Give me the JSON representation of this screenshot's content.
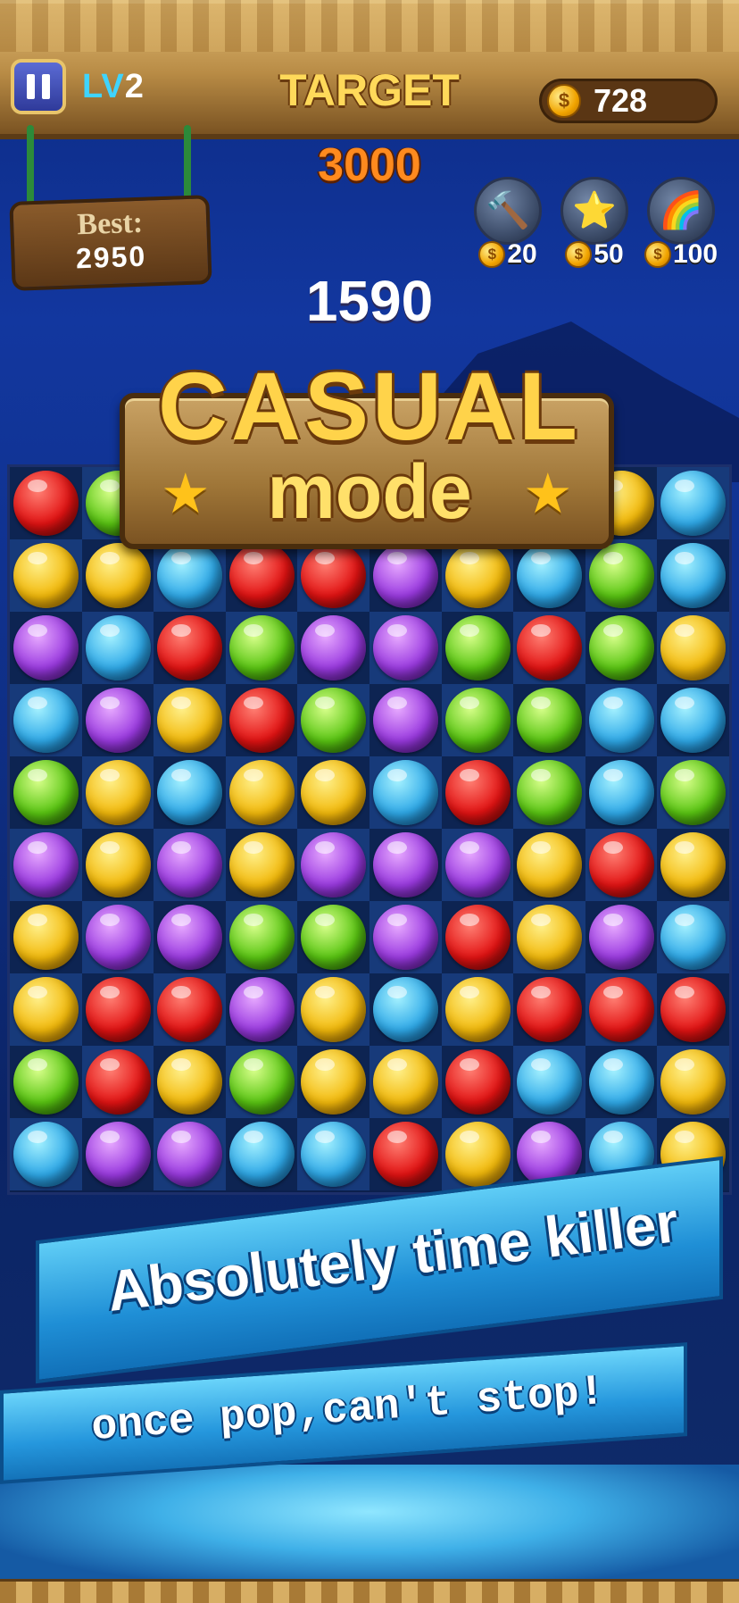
{
  "hud": {
    "level_prefix": "LV",
    "level": "2",
    "target_label": "TARGET",
    "target_value": "3000",
    "coins": "728",
    "coin_symbol": "$"
  },
  "best": {
    "label": "Best:",
    "value": "2950"
  },
  "boosters": [
    {
      "name": "hammer",
      "icon": "hammer-icon",
      "glyph": "🔨",
      "cost": "20"
    },
    {
      "name": "magic-wand",
      "icon": "star-wand-icon",
      "glyph": "⭐",
      "cost": "50"
    },
    {
      "name": "rainbow-ball",
      "icon": "rainbow-ball-icon",
      "glyph": "🌈",
      "cost": "100"
    }
  ],
  "score": "1590",
  "mode": {
    "title": "CASUAL",
    "subtitle": "mode"
  },
  "promo": {
    "slogan": "Absolutely time killer",
    "tagline": "once pop,can't stop!"
  },
  "board": {
    "rows": [
      [
        "red",
        "green",
        "",
        "",
        "",
        "",
        "",
        "",
        "yellow",
        "blue"
      ],
      [
        "yellow",
        "yellow",
        "blue",
        "red",
        "red",
        "purple",
        "yellow",
        "blue",
        "green",
        "blue"
      ],
      [
        "purple",
        "blue",
        "red",
        "green",
        "purple",
        "purple",
        "green",
        "red",
        "green",
        "yellow"
      ],
      [
        "blue",
        "purple",
        "yellow",
        "red",
        "green",
        "purple",
        "green",
        "green",
        "blue",
        "blue"
      ],
      [
        "green",
        "yellow",
        "blue",
        "yellow",
        "yellow",
        "blue",
        "red",
        "green",
        "blue",
        "green"
      ],
      [
        "purple",
        "yellow",
        "purple",
        "yellow",
        "purple",
        "purple",
        "purple",
        "yellow",
        "red",
        "yellow"
      ],
      [
        "yellow",
        "purple",
        "purple",
        "green",
        "green",
        "purple",
        "red",
        "yellow",
        "purple",
        "blue"
      ],
      [
        "yellow",
        "red",
        "red",
        "purple",
        "yellow",
        "blue",
        "yellow",
        "red",
        "red",
        "red"
      ],
      [
        "green",
        "red",
        "yellow",
        "green",
        "yellow",
        "yellow",
        "red",
        "blue",
        "blue",
        "yellow"
      ],
      [
        "blue",
        "purple",
        "purple",
        "blue",
        "blue",
        "red",
        "yellow",
        "purple",
        "blue",
        "yellow"
      ]
    ]
  },
  "colors": {
    "red": "#e21313",
    "yellow": "#f2b90b",
    "blue": "#2fa9e8",
    "green": "#59c512",
    "purple": "#9a3ae0",
    "gold": "#ffd34a"
  }
}
